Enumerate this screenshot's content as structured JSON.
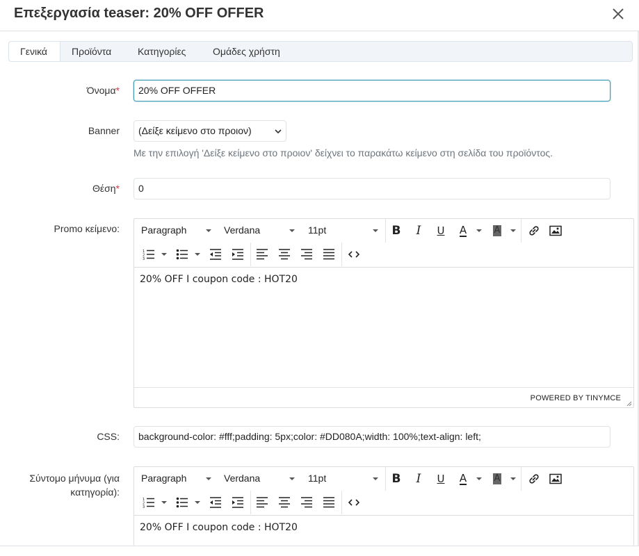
{
  "modal": {
    "title": "Επεξεργασία teaser: 20% OFF OFFER",
    "close_icon": "close-icon"
  },
  "tabs": [
    {
      "label": "Γενικά",
      "active": true
    },
    {
      "label": "Προϊόντα",
      "active": false
    },
    {
      "label": "Κατηγορίες",
      "active": false
    },
    {
      "label": "Ομάδες χρήστη",
      "active": false
    }
  ],
  "form": {
    "name": {
      "label": "Όνομα",
      "required": "*",
      "value": "20% OFF OFFER"
    },
    "banner": {
      "label": "Banner",
      "selected": "(Δείξε κείμενο στο προιον)",
      "help": "Με την επιλογή 'Δείξε κείμενο στο προιον' δείχνει το παρακάτω κείμενο στη σελίδα του προϊόντος."
    },
    "position": {
      "label": "Θέση",
      "required": "*",
      "value": "0"
    },
    "promo": {
      "label": "Promo κείμενο:",
      "content": "20% OFF I coupon code : HOT20"
    },
    "css": {
      "label": "CSS:",
      "value": "background-color: #fff;padding: 5px;color: #DD080A;width: 100%;text-align: left;"
    },
    "short_message": {
      "label_line1": "Σύντομο μήνυμα (για",
      "label_line2": "κατηγορία):",
      "content": "20% OFF I coupon code : HOT20"
    }
  },
  "editor": {
    "block_format": "Paragraph",
    "font_family": "Verdana",
    "font_size": "11pt",
    "bold": "B",
    "italic": "I",
    "underline": "U",
    "text_color": "A",
    "bg_color": "A",
    "powered_by": "POWERED BY TINYMCE"
  },
  "colors": {
    "focus_border": "#4aa3b8",
    "required": "#dc3545"
  }
}
